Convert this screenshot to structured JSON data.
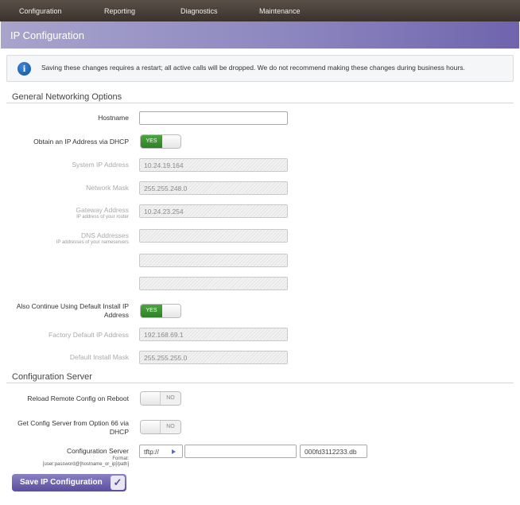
{
  "nav": {
    "items": [
      "Configuration",
      "Reporting",
      "Diagnostics",
      "Maintenance"
    ]
  },
  "page_title": "IP Configuration",
  "notice": {
    "icon": "info-icon",
    "text": "Saving these changes requires a restart; all active calls will be dropped. We do not recommend making these changes during business hours."
  },
  "general": {
    "heading": "General Networking Options",
    "hostname": {
      "label": "Hostname",
      "value": ""
    },
    "dhcp": {
      "label": "Obtain an IP Address via DHCP",
      "state": "YES"
    },
    "system_ip": {
      "label": "System IP Address",
      "value": "10.24.19.164"
    },
    "netmask": {
      "label": "Network Mask",
      "value": "255.255.248.0"
    },
    "gateway": {
      "label": "Gateway Address",
      "sub": "IP address of your router",
      "value": "10.24.23.254"
    },
    "dns": {
      "label": "DNS Addresses",
      "sub": "IP addresses of your nameservers",
      "values": [
        "",
        "",
        ""
      ]
    },
    "default_ip": {
      "label": "Also Continue Using Default Install IP Address",
      "state": "YES"
    },
    "factory_ip": {
      "label": "Factory Default IP Address",
      "value": "192.168.69.1"
    },
    "install_mask": {
      "label": "Default Install Mask",
      "value": "255.255.255.0"
    }
  },
  "config_server": {
    "heading": "Configuration Server",
    "reload": {
      "label": "Reload Remote Config on Reboot",
      "state": "NO"
    },
    "option66": {
      "label": "Get Config Server from Option 66 via DHCP",
      "state": "NO"
    },
    "server": {
      "label": "Configuration Server",
      "format_label": "Format:",
      "format": "[user:password@]hostname_or_ip[/path]",
      "protocol": "tftp://",
      "host": "",
      "file": "000fd3112233.db"
    }
  },
  "save_button": "Save IP Configuration"
}
